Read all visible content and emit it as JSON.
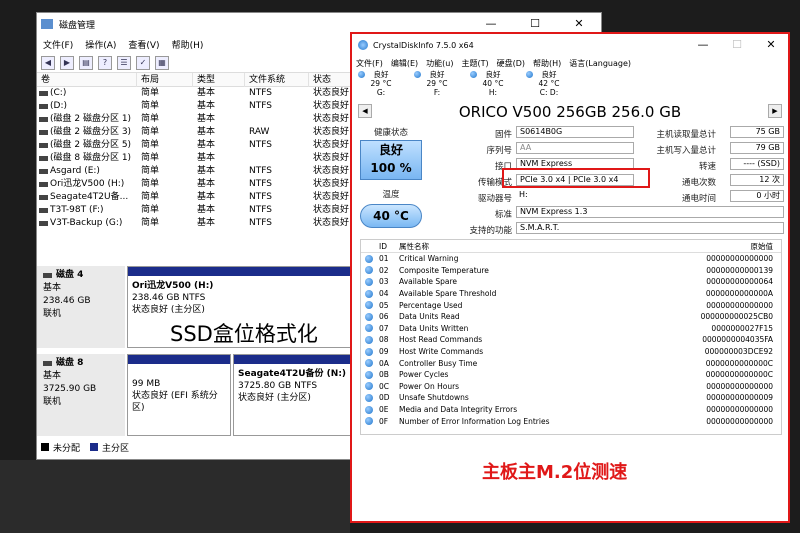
{
  "disk_mgmt": {
    "title": "磁盘管理",
    "menu": [
      "文件(F)",
      "操作(A)",
      "查看(V)",
      "帮助(H)"
    ],
    "columns": [
      "卷",
      "布局",
      "类型",
      "文件系统",
      "状态"
    ],
    "volumes": [
      [
        "(C:)",
        "简单",
        "基本",
        "NTFS",
        "状态良好"
      ],
      [
        "(D:)",
        "简单",
        "基本",
        "NTFS",
        "状态良好"
      ],
      [
        "(磁盘 2 磁盘分区 1)",
        "简单",
        "基本",
        "",
        "状态良好"
      ],
      [
        "(磁盘 2 磁盘分区 3)",
        "简单",
        "基本",
        "RAW",
        "状态良好"
      ],
      [
        "(磁盘 2 磁盘分区 5)",
        "简单",
        "基本",
        "NTFS",
        "状态良好"
      ],
      [
        "(磁盘 8 磁盘分区 1)",
        "简单",
        "基本",
        "",
        "状态良好"
      ],
      [
        "Asgard (E:)",
        "简单",
        "基本",
        "NTFS",
        "状态良好"
      ],
      [
        "Ori迅龙V500 (H:)",
        "简单",
        "基本",
        "NTFS",
        "状态良好"
      ],
      [
        "Seagate4T2U备...",
        "简单",
        "基本",
        "NTFS",
        "状态良好"
      ],
      [
        "T3T-98T (F:)",
        "简单",
        "基本",
        "NTFS",
        "状态良好"
      ],
      [
        "V3T-Backup (G:)",
        "简单",
        "基本",
        "NTFS",
        "状态良好"
      ]
    ],
    "disk4": {
      "name": "磁盘 4",
      "type": "基本",
      "size": "238.46 GB",
      "status": "联机",
      "part_name": "Ori迅龙V500  (H:)",
      "part_size": "238.46 GB NTFS",
      "part_status": "状态良好 (主分区)"
    },
    "disk8": {
      "name": "磁盘 8",
      "type": "基本",
      "size": "3725.90 GB",
      "status": "联机",
      "p1_size": "99 MB",
      "p1_status": "状态良好 (EFI 系统分区)",
      "p2_name": "Seagate4T2U备份  (N:)",
      "p2_size": "3725.80 GB NTFS",
      "p2_status": "状态良好 (主分区)"
    },
    "legend": [
      "未分配",
      "主分区"
    ],
    "overlay": "SSD盒位格式化"
  },
  "cdi": {
    "title": "CrystalDiskInfo 7.5.0 x64",
    "menu": [
      "文件(F)",
      "编辑(E)",
      "功能(u)",
      "主题(T)",
      "硬盘(D)",
      "帮助(H)",
      "语言(Language)"
    ],
    "drives": [
      {
        "s": "良好",
        "t": "29 °C",
        "l": "G:"
      },
      {
        "s": "良好",
        "t": "29 °C",
        "l": "F:"
      },
      {
        "s": "良好",
        "t": "40 °C",
        "l": "H:"
      },
      {
        "s": "良好",
        "t": "42 °C",
        "l": "C: D:"
      }
    ],
    "model": "ORICO V500 256GB 256.0 GB",
    "health_label": "健康状态",
    "health_status": "良好",
    "health_pct": "100 %",
    "temp_label": "温度",
    "temp": "40 °C",
    "fw_label": "固件",
    "fw": "S0614B0G",
    "sn_label": "序列号",
    "sn": "AA",
    "if_label": "接口",
    "if": "NVM Express",
    "tm_label": "传输模式",
    "tm": "PCIe 3.0 x4 | PCIe 3.0 x4",
    "dl_label": "驱动器号",
    "dl": "H:",
    "std_label": "标准",
    "std": "NVM Express 1.3",
    "feat_label": "支持的功能",
    "feat": "S.M.A.R.T.",
    "read_label": "主机读取量总计",
    "read": "75 GB",
    "write_label": "主机写入量总计",
    "write": "79 GB",
    "rpm_label": "转速",
    "rpm": "---- (SSD)",
    "poc_label": "通电次数",
    "poc": "12 次",
    "poh_label": "通电时间",
    "poh": "0 小时",
    "smart_cols": [
      "ID",
      "属性名称",
      "原始值"
    ],
    "smart": [
      [
        "01",
        "Critical Warning",
        "00000000000000"
      ],
      [
        "02",
        "Composite Temperature",
        "00000000000139"
      ],
      [
        "03",
        "Available Spare",
        "00000000000064"
      ],
      [
        "04",
        "Available Spare Threshold",
        "0000000000000A"
      ],
      [
        "05",
        "Percentage Used",
        "00000000000000"
      ],
      [
        "06",
        "Data Units Read",
        "000000000025CB0"
      ],
      [
        "07",
        "Data Units Written",
        "0000000027F15"
      ],
      [
        "08",
        "Host Read Commands",
        "0000000004035FA"
      ],
      [
        "09",
        "Host Write Commands",
        "000000003DCE92"
      ],
      [
        "0A",
        "Controller Busy Time",
        "0000000000000C"
      ],
      [
        "0B",
        "Power Cycles",
        "0000000000000C"
      ],
      [
        "0C",
        "Power On Hours",
        "00000000000000"
      ],
      [
        "0D",
        "Unsafe Shutdowns",
        "00000000000009"
      ],
      [
        "0E",
        "Media and Data Integrity Errors",
        "00000000000000"
      ],
      [
        "0F",
        "Number of Error Information Log Entries",
        "00000000000000"
      ]
    ],
    "overlay": "主板主M.2位测速"
  }
}
